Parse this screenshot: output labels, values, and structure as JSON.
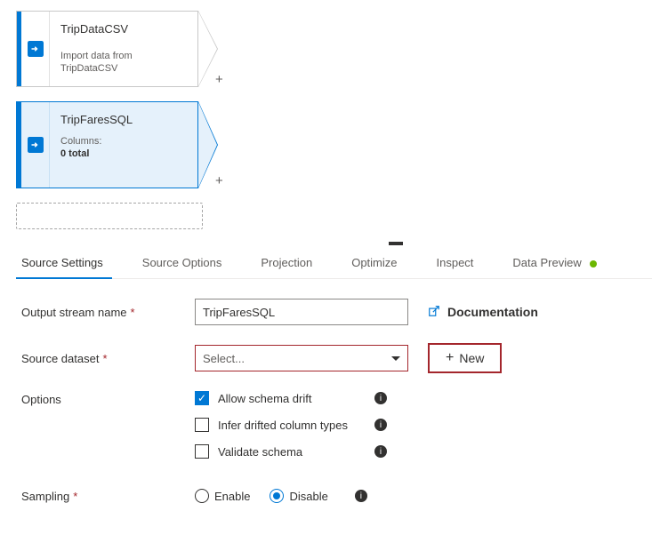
{
  "nodes": [
    {
      "title": "TripDataCSV",
      "subtitle": "Import data from TripDataCSV",
      "selected": false,
      "icon": "source-icon"
    },
    {
      "title": "TripFaresSQL",
      "columns_label": "Columns:",
      "columns_count": "0 total",
      "selected": true,
      "icon": "source-icon"
    }
  ],
  "tabs": {
    "items": [
      {
        "label": "Source Settings",
        "active": true
      },
      {
        "label": "Source Options",
        "active": false
      },
      {
        "label": "Projection",
        "active": false
      },
      {
        "label": "Optimize",
        "active": false
      },
      {
        "label": "Inspect",
        "active": false
      },
      {
        "label": "Data Preview",
        "active": false,
        "has_status_dot": true
      }
    ]
  },
  "form": {
    "output_stream": {
      "label": "Output stream name",
      "value": "TripFaresSQL"
    },
    "source_dataset": {
      "label": "Source dataset",
      "placeholder": "Select...",
      "new_label": "New"
    },
    "documentation_label": "Documentation",
    "options": {
      "label": "Options",
      "checks": [
        {
          "label": "Allow schema drift",
          "checked": true
        },
        {
          "label": "Infer drifted column types",
          "checked": false
        },
        {
          "label": "Validate schema",
          "checked": false
        }
      ]
    },
    "sampling": {
      "label": "Sampling",
      "enable_label": "Enable",
      "disable_label": "Disable",
      "value": "disable"
    }
  }
}
